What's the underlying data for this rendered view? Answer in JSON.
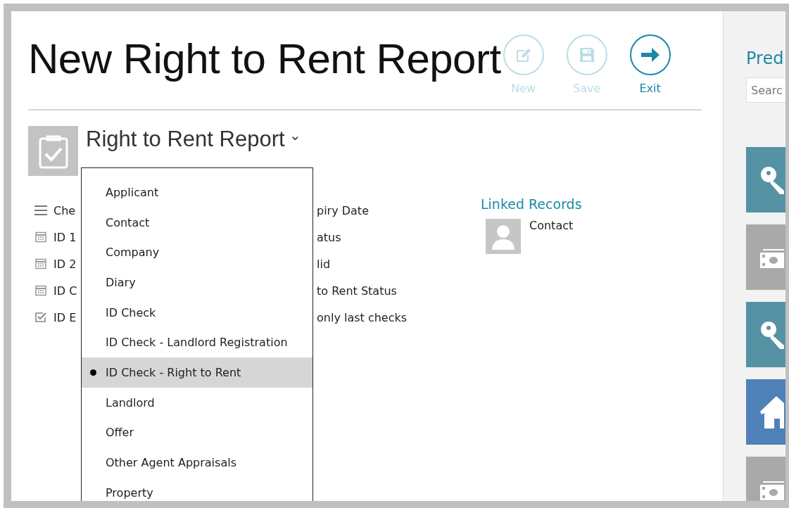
{
  "title": "New Right to Rent Report",
  "actions": [
    {
      "label": "New",
      "kind": "edit",
      "disabled": true
    },
    {
      "label": "Save",
      "kind": "save",
      "disabled": true
    },
    {
      "label": "Exit",
      "kind": "exit",
      "disabled": false
    }
  ],
  "report": {
    "heading": "Right to Rent Report",
    "caret": "⌄"
  },
  "fields": [
    {
      "kind": "list",
      "left": "Che",
      "right": "piry Date"
    },
    {
      "kind": "date",
      "left": "ID 1",
      "right": "atus"
    },
    {
      "kind": "date",
      "left": "ID 2",
      "right": "lid"
    },
    {
      "kind": "date",
      "left": "ID C",
      "right": "to Rent Status"
    },
    {
      "kind": "check",
      "left": "ID E",
      "right": "only last checks"
    }
  ],
  "linked_records": {
    "heading": "Linked Records",
    "items": [
      {
        "label": "Contact"
      }
    ]
  },
  "dropdown": [
    {
      "label": "Applicant",
      "selected": false
    },
    {
      "label": "Contact",
      "selected": false
    },
    {
      "label": "Company",
      "selected": false
    },
    {
      "label": "Diary",
      "selected": false
    },
    {
      "label": "ID Check",
      "selected": false
    },
    {
      "label": "ID Check - Landlord Registration",
      "selected": false
    },
    {
      "label": "ID Check - Right to Rent",
      "selected": true
    },
    {
      "label": "Landlord",
      "selected": false
    },
    {
      "label": "Offer",
      "selected": false
    },
    {
      "label": "Other Agent Appraisals",
      "selected": false
    },
    {
      "label": "Property",
      "selected": false
    }
  ],
  "side_panel": {
    "heading": "Pred",
    "search": {
      "placeholder": "Searc"
    },
    "tiles": [
      {
        "kind": "key",
        "color": "#5592a4"
      },
      {
        "kind": "money",
        "color": "#a9a9a9"
      },
      {
        "kind": "key",
        "color": "#5592a4"
      },
      {
        "kind": "house",
        "color": "#4f81b8"
      },
      {
        "kind": "money",
        "color": "#a9a9a9"
      }
    ]
  }
}
